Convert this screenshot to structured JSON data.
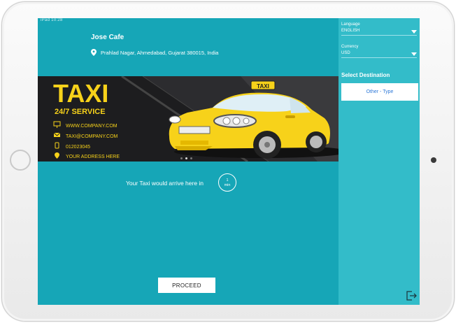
{
  "status": {
    "text": "iPad  10:28"
  },
  "cafe": {
    "name": "Jose Cafe",
    "address": "Prahlad Nagar, Ahmedabad, Gujarat 380015, India"
  },
  "banner": {
    "title": "TAXI",
    "subtitle": "24/7 SERVICE",
    "sign": "TAXI",
    "contacts": [
      {
        "icon": "monitor-icon",
        "text": "WWW.COMPANY.COM"
      },
      {
        "icon": "mail-icon",
        "text": "TAXI@COMPANY.COM"
      },
      {
        "icon": "phone-icon",
        "text": "012023045"
      },
      {
        "icon": "location-pin-icon",
        "text": "YOUR ADDRESS HERE"
      }
    ],
    "slide_dots": {
      "count": 3,
      "active": 2
    }
  },
  "arrival": {
    "text": "Your Taxi would arrive here in",
    "value": "1",
    "unit": "min"
  },
  "proceed_label": "PROCEED",
  "sidebar": {
    "language_label": "Language",
    "language_value": "ENGLISH",
    "currency_label": "Currency",
    "currency_value": "USD",
    "destination_heading": "Select Destination",
    "destination_option": "Other - Type"
  },
  "colors": {
    "main_bg": "#16a6b7",
    "sidebar_bg": "#33bcc9",
    "taxi_yellow": "#f7d21a",
    "link_blue": "#2f79d8"
  }
}
